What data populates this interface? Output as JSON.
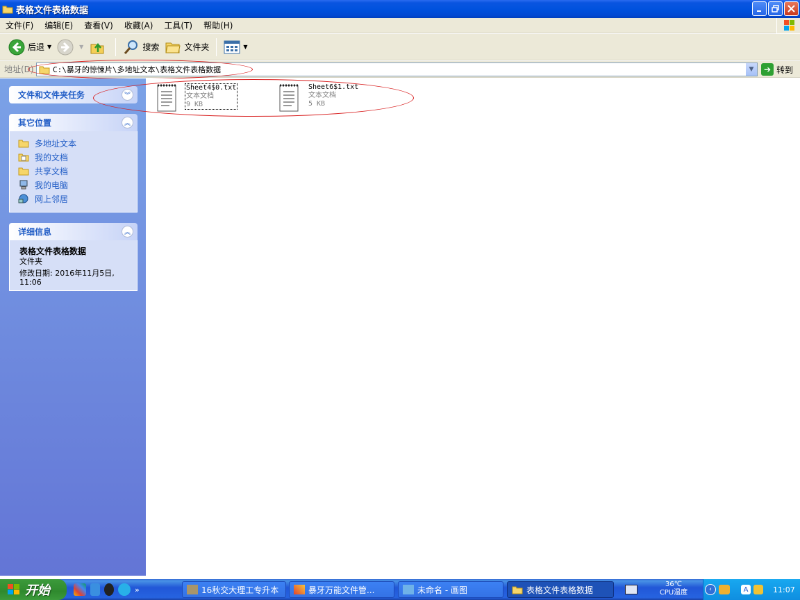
{
  "window": {
    "title": "表格文件表格数据"
  },
  "menu": [
    "文件(F)",
    "编辑(E)",
    "查看(V)",
    "收藏(A)",
    "工具(T)",
    "帮助(H)"
  ],
  "toolbar": {
    "back_label": "后退",
    "search_label": "搜索",
    "folders_label": "文件夹"
  },
  "address": {
    "label": "地址(D)",
    "path": "C:\\暴牙的惊悚片\\多地址文本\\表格文件表格数据",
    "go_label": "转到"
  },
  "sidebar": {
    "tasks_title": "文件和文件夹任务",
    "places_title": "其它位置",
    "places": [
      {
        "label": "多地址文本",
        "icon": "folder-icon"
      },
      {
        "label": "我的文档",
        "icon": "my-documents-icon"
      },
      {
        "label": "共享文档",
        "icon": "folder-icon"
      },
      {
        "label": "我的电脑",
        "icon": "my-computer-icon"
      },
      {
        "label": "网上邻居",
        "icon": "network-icon"
      }
    ],
    "details_title": "详细信息",
    "details": {
      "name": "表格文件表格数据",
      "type": "文件夹",
      "modified": "修改日期: 2016年11月5日, 11:06"
    }
  },
  "files": [
    {
      "name": "Sheet4$0.txt",
      "type": "文本文档",
      "size": "9 KB"
    },
    {
      "name": "Sheet6$1.txt",
      "type": "文本文档",
      "size": "5 KB"
    }
  ],
  "taskbar": {
    "start_label": "开始",
    "tasks": [
      {
        "label": "16秋交大理工专升本"
      },
      {
        "label": "暴牙万能文件管..."
      },
      {
        "label": "未命名 - 画图"
      },
      {
        "label": "表格文件表格数据"
      }
    ],
    "cpu_temp": "36℃",
    "cpu_label": "CPU温度",
    "clock": "11:07"
  },
  "colors": {
    "titlebar": "#0052de",
    "sidebar_link": "#215dc6",
    "annotation": "#d81e1e",
    "start_green": "#3c9a3b"
  }
}
